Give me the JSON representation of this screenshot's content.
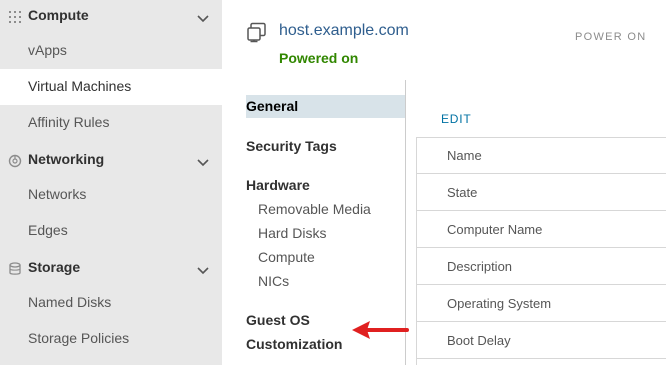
{
  "sidebar": {
    "sections": [
      {
        "label": "Compute",
        "icon": "grid-icon",
        "items": [
          "vApps",
          "Virtual Machines",
          "Affinity Rules"
        ]
      },
      {
        "label": "Networking",
        "icon": "network-icon",
        "items": [
          "Networks",
          "Edges"
        ]
      },
      {
        "label": "Storage",
        "icon": "database-icon",
        "items": [
          "Named Disks",
          "Storage Policies"
        ]
      }
    ],
    "active_item": "Virtual Machines"
  },
  "header": {
    "vm_name": "host.example.com",
    "status": "Powered on",
    "power_action": "POWER ON"
  },
  "inner_nav": {
    "general": "General",
    "security_tags": "Security Tags",
    "hardware": "Hardware",
    "hardware_items": [
      "Removable Media",
      "Hard Disks",
      "Compute",
      "NICs"
    ],
    "guest_os_line1": "Guest OS",
    "guest_os_line2": "Customization"
  },
  "properties": {
    "edit_label": "EDIT",
    "rows": [
      "Name",
      "State",
      "Computer Name",
      "Description",
      "Operating System",
      "Boot Delay"
    ]
  },
  "colors": {
    "link": "#2f5e8e",
    "status_green": "#318700",
    "annotation_red": "#e02020",
    "selected_bg": "#d8e3e9"
  }
}
